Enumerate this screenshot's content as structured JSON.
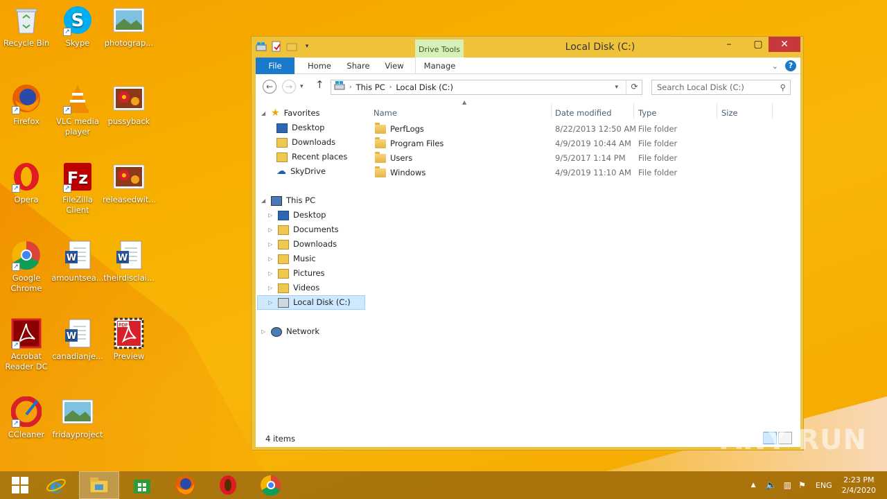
{
  "desktop": {
    "icons": [
      {
        "label": "Recycle Bin"
      },
      {
        "label": "Skype"
      },
      {
        "label": "photograp..."
      },
      {
        "label": "Firefox"
      },
      {
        "label": "VLC media player"
      },
      {
        "label": "pussyback"
      },
      {
        "label": "Opera"
      },
      {
        "label": "FileZilla Client"
      },
      {
        "label": "releasedwit..."
      },
      {
        "label": "Google Chrome"
      },
      {
        "label": "amountsea..."
      },
      {
        "label": "theirdisclai..."
      },
      {
        "label": "Acrobat Reader DC"
      },
      {
        "label": "canadianje..."
      },
      {
        "label": "Preview"
      },
      {
        "label": "CCleaner"
      },
      {
        "label": "fridayproject"
      }
    ]
  },
  "window": {
    "title": "Local Disk (C:)",
    "context_tab": "Drive Tools",
    "ribbon_tabs": [
      "File",
      "Home",
      "Share",
      "View",
      "Manage"
    ],
    "address": {
      "segments": [
        "This PC",
        "Local Disk (C:)"
      ]
    },
    "search_placeholder": "Search Local Disk (C:)",
    "nav": {
      "favorites_label": "Favorites",
      "favorites": [
        "Desktop",
        "Downloads",
        "Recent places",
        "SkyDrive"
      ],
      "thispc_label": "This PC",
      "thispc": [
        "Desktop",
        "Documents",
        "Downloads",
        "Music",
        "Pictures",
        "Videos",
        "Local Disk (C:)"
      ],
      "network_label": "Network"
    },
    "columns": [
      "Name",
      "Date modified",
      "Type",
      "Size"
    ],
    "files": [
      {
        "name": "PerfLogs",
        "date": "8/22/2013 12:50 AM",
        "type": "File folder"
      },
      {
        "name": "Program Files",
        "date": "4/9/2019 10:44 AM",
        "type": "File folder"
      },
      {
        "name": "Users",
        "date": "9/5/2017 1:14 PM",
        "type": "File folder"
      },
      {
        "name": "Windows",
        "date": "4/9/2019 11:10 AM",
        "type": "File folder"
      }
    ],
    "status": "4 items"
  },
  "watermark": "ANY RUN",
  "taskbar": {
    "lang": "ENG",
    "time": "2:23 PM",
    "date": "2/4/2020"
  }
}
